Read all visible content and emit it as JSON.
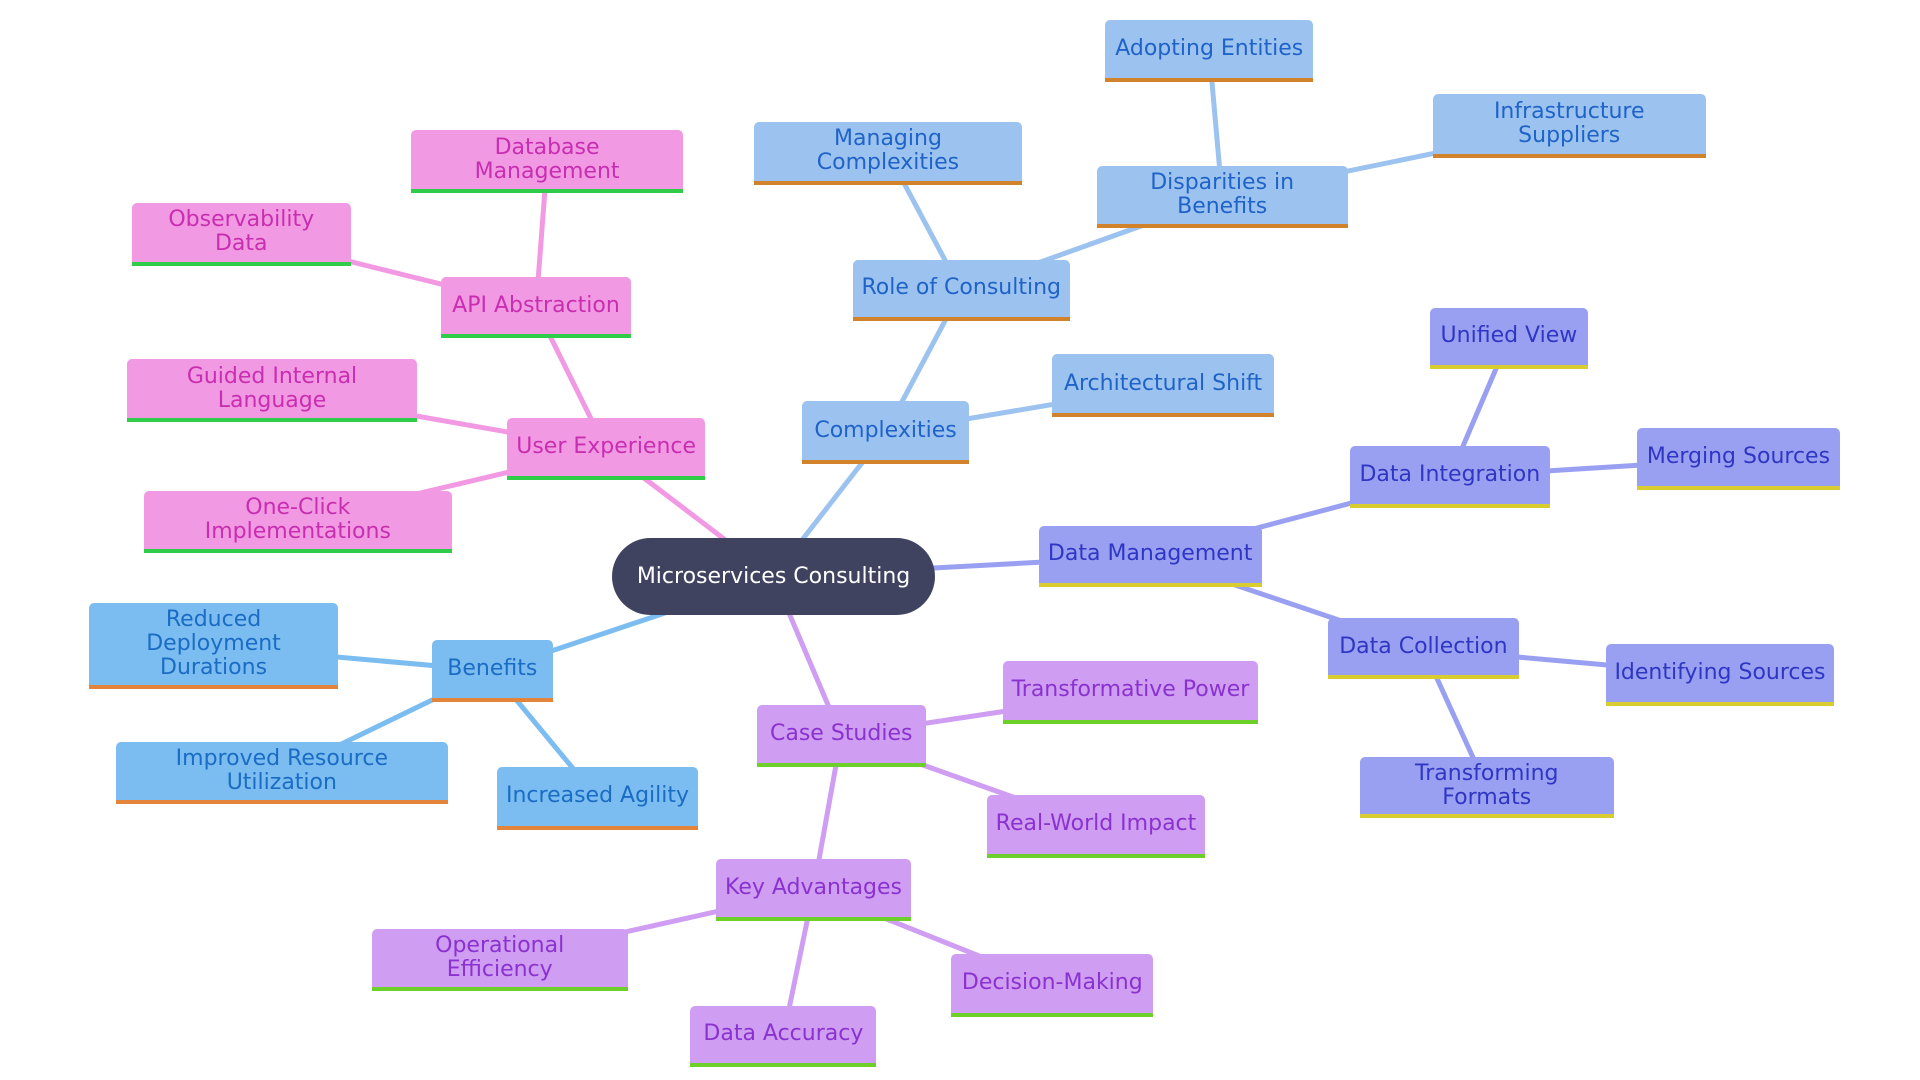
{
  "title": "Microservices Consulting",
  "palettes": {
    "root": {
      "fill": "#3f4360",
      "text": "#ffffff",
      "bar": "#3f4360",
      "edge": "#3f4360"
    },
    "pink": {
      "fill": "#f299e3",
      "text": "#c82eb0",
      "bar": "#2fcc4a",
      "edge": "#f299e3"
    },
    "sky": {
      "fill": "#9cc3ef",
      "text": "#1f63c8",
      "bar": "#d2822a",
      "edge": "#9cc3ef"
    },
    "blue": {
      "fill": "#7bbdf0",
      "text": "#1a6cc4",
      "bar": "#e3843a",
      "edge": "#7bbdf0"
    },
    "indigo": {
      "fill": "#9aa0f1",
      "text": "#2f36c4",
      "bar": "#d8cc2e",
      "edge": "#9aa0f1"
    },
    "violet": {
      "fill": "#cf9df1",
      "text": "#8a32cf",
      "bar": "#6ccf2a",
      "edge": "#cf9df1"
    }
  },
  "nodes": [
    {
      "id": "root",
      "label": "Microservices Consulting",
      "palette": "root"
    },
    {
      "id": "ux",
      "label": "User Experience",
      "palette": "pink",
      "parent": "root"
    },
    {
      "id": "api",
      "label": "API Abstraction",
      "palette": "pink",
      "parent": "ux"
    },
    {
      "id": "dbm",
      "label": "Database Management",
      "palette": "pink",
      "parent": "api"
    },
    {
      "id": "obs",
      "label": "Observability Data",
      "palette": "pink",
      "parent": "api"
    },
    {
      "id": "gil",
      "label": "Guided Internal Language",
      "palette": "pink",
      "parent": "ux"
    },
    {
      "id": "oci",
      "label": "One-Click Implementations",
      "palette": "pink",
      "parent": "ux"
    },
    {
      "id": "cx",
      "label": "Complexities",
      "palette": "sky",
      "parent": "root"
    },
    {
      "id": "roc",
      "label": "Role of Consulting",
      "palette": "sky",
      "parent": "cx"
    },
    {
      "id": "mc",
      "label": "Managing Complexities",
      "palette": "sky",
      "parent": "roc"
    },
    {
      "id": "dib",
      "label": "Disparities in Benefits",
      "palette": "sky",
      "parent": "roc"
    },
    {
      "id": "ae",
      "label": "Adopting Entities",
      "palette": "sky",
      "parent": "dib"
    },
    {
      "id": "is",
      "label": "Infrastructure Suppliers",
      "palette": "sky",
      "parent": "dib"
    },
    {
      "id": "as",
      "label": "Architectural Shift",
      "palette": "sky",
      "parent": "cx"
    },
    {
      "id": "dm",
      "label": "Data Management",
      "palette": "indigo",
      "parent": "root"
    },
    {
      "id": "di",
      "label": "Data Integration",
      "palette": "indigo",
      "parent": "dm"
    },
    {
      "id": "uv",
      "label": "Unified View",
      "palette": "indigo",
      "parent": "di"
    },
    {
      "id": "ms",
      "label": "Merging Sources",
      "palette": "indigo",
      "parent": "di"
    },
    {
      "id": "dc",
      "label": "Data Collection",
      "palette": "indigo",
      "parent": "dm"
    },
    {
      "id": "ids",
      "label": "Identifying Sources",
      "palette": "indigo",
      "parent": "dc"
    },
    {
      "id": "tf",
      "label": "Transforming Formats",
      "palette": "indigo",
      "parent": "dc"
    },
    {
      "id": "ben",
      "label": "Benefits",
      "palette": "blue",
      "parent": "root"
    },
    {
      "id": "rdd",
      "label": "Reduced Deployment Durations",
      "palette": "blue",
      "parent": "ben"
    },
    {
      "id": "iru",
      "label": "Improved Resource Utilization",
      "palette": "blue",
      "parent": "ben"
    },
    {
      "id": "ia",
      "label": "Increased Agility",
      "palette": "blue",
      "parent": "ben"
    },
    {
      "id": "cs",
      "label": "Case Studies",
      "palette": "violet",
      "parent": "root"
    },
    {
      "id": "tp",
      "label": "Transformative Power",
      "palette": "violet",
      "parent": "cs"
    },
    {
      "id": "rwi",
      "label": "Real-World Impact",
      "palette": "violet",
      "parent": "cs"
    },
    {
      "id": "ka",
      "label": "Key Advantages",
      "palette": "violet",
      "parent": "cs"
    },
    {
      "id": "oe",
      "label": "Operational Efficiency",
      "palette": "violet",
      "parent": "ka"
    },
    {
      "id": "dmk",
      "label": "Decision-Making",
      "palette": "violet",
      "parent": "ka"
    },
    {
      "id": "da",
      "label": "Data Accuracy",
      "palette": "violet",
      "parent": "ka"
    }
  ]
}
